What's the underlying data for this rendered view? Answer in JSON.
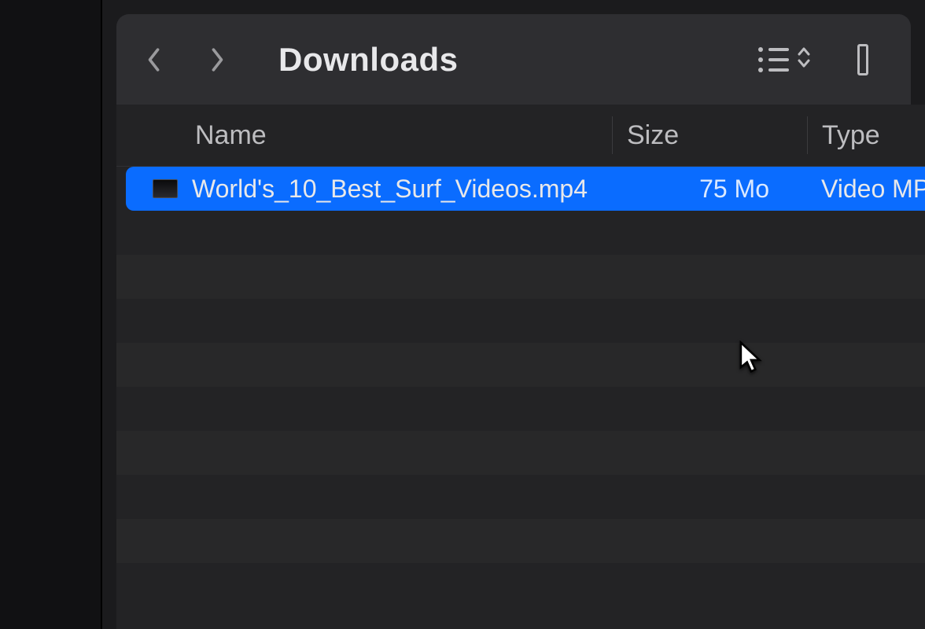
{
  "location_title": "Downloads",
  "columns": {
    "name": "Name",
    "size": "Size",
    "type": "Type"
  },
  "files": [
    {
      "name": "World's_10_Best_Surf_Videos.mp4",
      "size": "75 Mo",
      "type": "Video MP",
      "selected": true
    }
  ],
  "icons": {
    "back": "chevron-left-icon",
    "forward": "chevron-right-icon",
    "view_list": "list-view-icon",
    "view_sort": "sort-updown-icon",
    "view_columns": "column-view-icon",
    "file": "video-file-icon"
  }
}
